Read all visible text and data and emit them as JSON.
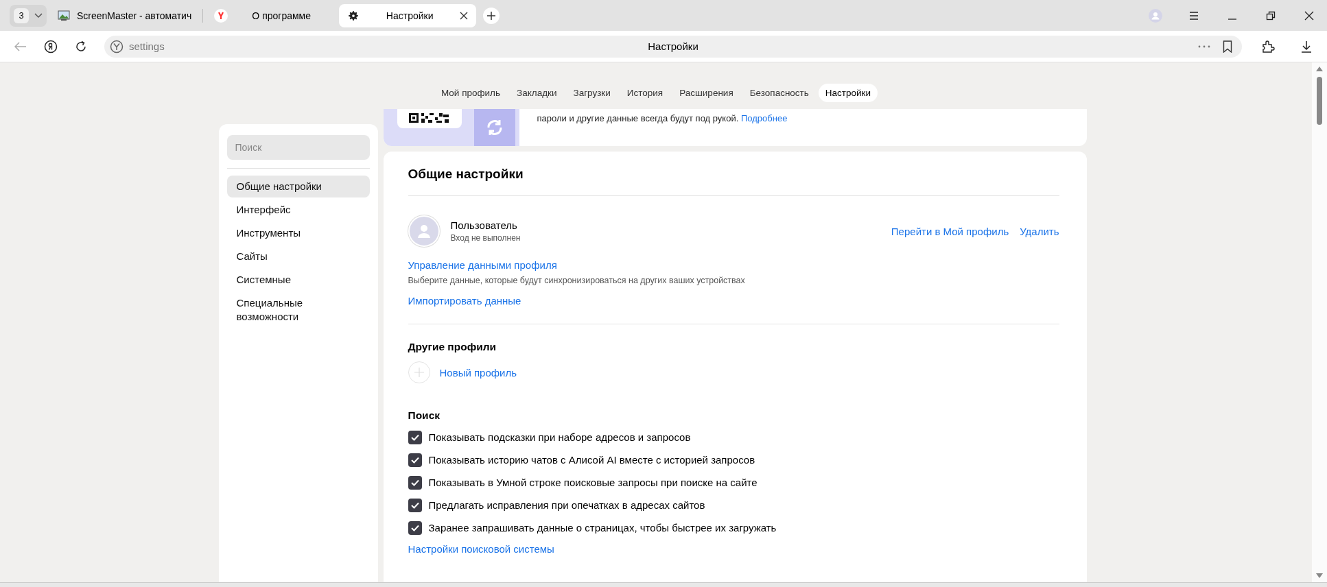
{
  "browser": {
    "tab_count": "3",
    "tabs": [
      {
        "title": "ScreenMaster - автоматич",
        "kind": "screenmaster",
        "selected": false
      },
      {
        "title": "О программе",
        "kind": "yandex",
        "selected": false
      },
      {
        "title": "Настройки",
        "kind": "settings",
        "selected": true
      }
    ],
    "address": {
      "value": "settings",
      "page_title": "Настройки"
    }
  },
  "nav": [
    {
      "label": "Мой профиль",
      "selected": false
    },
    {
      "label": "Закладки",
      "selected": false
    },
    {
      "label": "Загрузки",
      "selected": false
    },
    {
      "label": "История",
      "selected": false
    },
    {
      "label": "Расширения",
      "selected": false
    },
    {
      "label": "Безопасность",
      "selected": false
    },
    {
      "label": "Настройки",
      "selected": true
    }
  ],
  "sidebar": {
    "search": {
      "placeholder": "Поиск"
    },
    "items": [
      {
        "label": "Общие настройки",
        "selected": true
      },
      {
        "label": "Интерфейс",
        "selected": false
      },
      {
        "label": "Инструменты",
        "selected": false
      },
      {
        "label": "Сайты",
        "selected": false
      },
      {
        "label": "Системные",
        "selected": false
      },
      {
        "label": "Специальные возможности",
        "selected": false
      }
    ]
  },
  "sync_banner": {
    "text": "пароли и другие данные всегда будут под рукой.",
    "link": "Подробнее"
  },
  "general": {
    "title": "Общие настройки",
    "profile": {
      "name": "Пользователь",
      "status": "Вход не выполнен",
      "actions": [
        "Перейти в Мой профиль",
        "Удалить"
      ]
    },
    "manage_link": "Управление данными профиля",
    "manage_hint": "Выберите данные, которые будут синхронизироваться на других ваших устройствах",
    "import_link": "Импортировать данные",
    "other_profiles": {
      "title": "Другие профили",
      "new_profile": "Новый профиль"
    },
    "search": {
      "title": "Поиск",
      "options": [
        {
          "label": "Показывать подсказки при наборе адресов и запросов",
          "checked": true
        },
        {
          "label": "Показывать историю чатов с Алисой AI вместе с историей запросов",
          "checked": true
        },
        {
          "label": "Показывать в Умной строке поисковые запросы при поиске на сайте",
          "checked": true
        },
        {
          "label": "Предлагать исправления при опечатках в адресах сайтов",
          "checked": true
        },
        {
          "label": "Заранее запрашивать данные о страницах, чтобы быстрее их загружать",
          "checked": true
        }
      ],
      "engine_link": "Настройки поисковой системы"
    }
  }
}
